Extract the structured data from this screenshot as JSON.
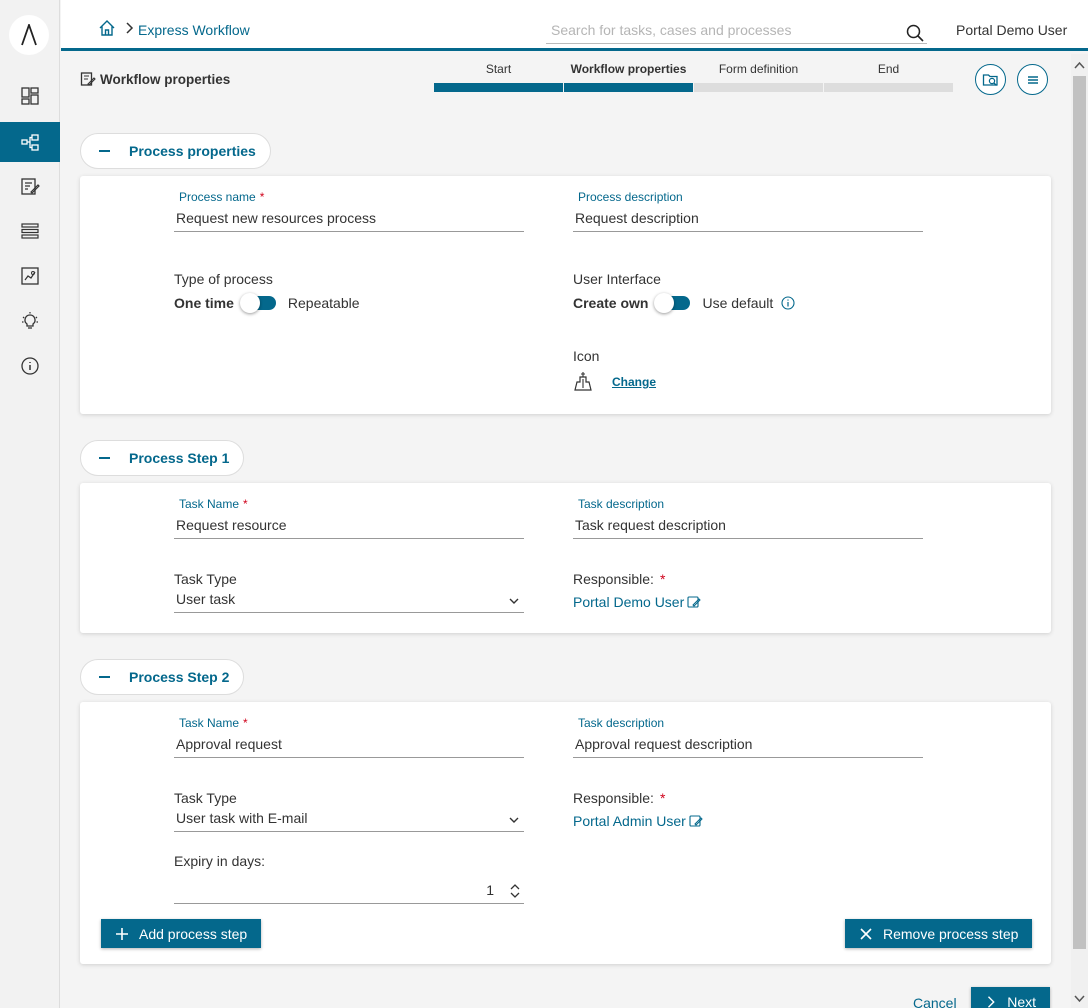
{
  "header": {
    "breadcrumb": "Express Workflow",
    "search_placeholder": "Search for tasks, cases and processes",
    "user": "Portal Demo User"
  },
  "page": {
    "title": "Workflow properties"
  },
  "steps": [
    {
      "label": "Start",
      "state": "done"
    },
    {
      "label": "Workflow properties",
      "state": "current"
    },
    {
      "label": "Form definition",
      "state": "todo"
    },
    {
      "label": "End",
      "state": "todo"
    }
  ],
  "process_properties": {
    "section_label": "Process properties",
    "process_name_label": "Process name",
    "process_name_value": "Request new resources process",
    "process_description_label": "Process description",
    "process_description_value": "Request description",
    "type_label": "Type of process",
    "type_option_left": "One time",
    "type_option_right": "Repeatable",
    "ui_label": "User Interface",
    "ui_option_left": "Create own",
    "ui_option_right": "Use default",
    "icon_label": "Icon",
    "icon_change": "Change"
  },
  "step1": {
    "section_label": "Process Step 1",
    "task_name_label": "Task Name",
    "task_name_value": "Request resource",
    "task_description_label": "Task description",
    "task_description_value": "Task request description",
    "task_type_label": "Task Type",
    "task_type_value": "User task",
    "responsible_label": "Responsible:",
    "responsible_value": "Portal Demo User"
  },
  "step2": {
    "section_label": "Process Step 2",
    "task_name_label": "Task Name",
    "task_name_value": "Approval request",
    "task_description_label": "Task description",
    "task_description_value": "Approval request description",
    "task_type_label": "Task Type",
    "task_type_value": "User task with E-mail",
    "responsible_label": "Responsible:",
    "responsible_value": "Portal Admin User",
    "expiry_label": "Expiry in days:",
    "expiry_value": "1"
  },
  "actions": {
    "add_step": "Add process step",
    "remove_step": "Remove process step",
    "cancel": "Cancel",
    "next": "Next"
  },
  "colors": {
    "accent": "#04688c",
    "required": "#d0021b"
  }
}
